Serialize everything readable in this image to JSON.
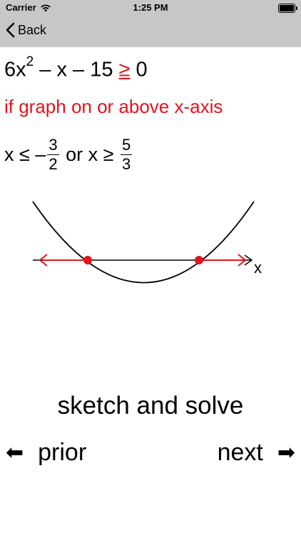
{
  "status": {
    "carrier": "Carrier",
    "time": "1:25 PM"
  },
  "nav": {
    "back_label": "Back"
  },
  "problem": {
    "lead": "6x",
    "exponent": "2",
    "rest": " – x – 15 ",
    "operator": "≥",
    "rhs": " 0"
  },
  "condition": "if graph on or above x-axis",
  "solution": {
    "left_part": "x ≤ –",
    "left_num": "3",
    "left_den": "2",
    "middle": " or x ≥ ",
    "right_num": "5",
    "right_den": "3"
  },
  "graph": {
    "axis_label": "x",
    "curve_color": "#000000",
    "solution_color": "#e3141c"
  },
  "footer": {
    "title": "sketch and solve",
    "prior_label": "prior",
    "next_label": "next",
    "prior_arrow": "⬅",
    "next_arrow": "➡"
  }
}
